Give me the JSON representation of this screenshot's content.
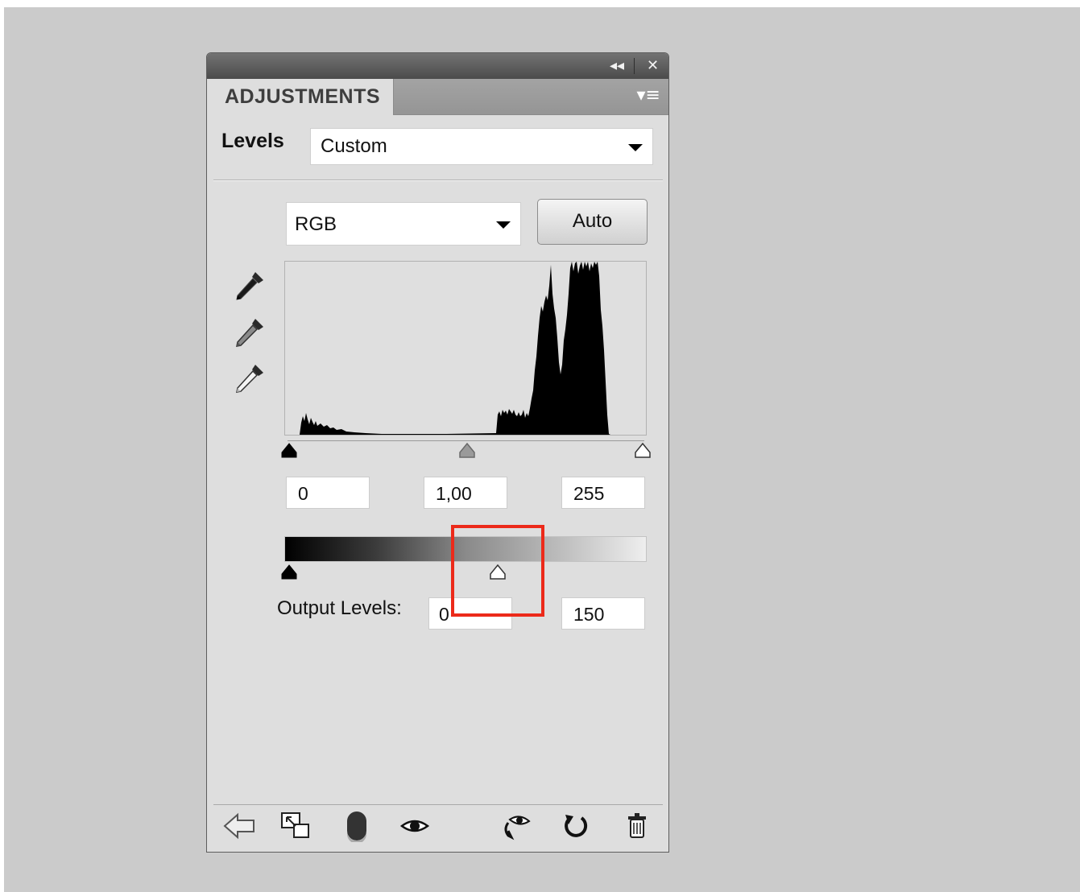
{
  "panel": {
    "tab_label": "ADJUSTMENTS",
    "titlebar_buttons": {
      "collapse": "◂◂",
      "close": "✕"
    },
    "menu_glyph": "▾≡"
  },
  "preset": {
    "label": "Levels",
    "value": "Custom"
  },
  "channel": {
    "value": "RGB",
    "auto_label": "Auto"
  },
  "eyedroppers": [
    "black-point-eyedropper-icon",
    "gray-point-eyedropper-icon",
    "white-point-eyedropper-icon"
  ],
  "input_levels": {
    "shadows": "0",
    "midtones": "1,00",
    "highlights": "255"
  },
  "output_levels": {
    "label": "Output Levels:",
    "shadows": "0",
    "highlights": "150"
  },
  "histogram": {
    "channel": "RGB",
    "input_range": [
      0,
      255
    ],
    "shape_note_levels": {
      "dark_cluster_range": [
        10,
        50
      ],
      "mid_cluster_range": [
        150,
        175
      ],
      "main_peaks_range": [
        175,
        230
      ]
    }
  },
  "bottom_toolbar": [
    "return-to-list-icon",
    "clip-to-layer-icon",
    "layer-mask-visibility-icon",
    "view-previous-state-icon",
    "toggle-visibility-icon",
    "reset-icon",
    "delete-icon"
  ],
  "colors": {
    "panel_bg": "#dedede",
    "titlebar": "#5b5b5b",
    "highlight": "#ec2a1a"
  }
}
